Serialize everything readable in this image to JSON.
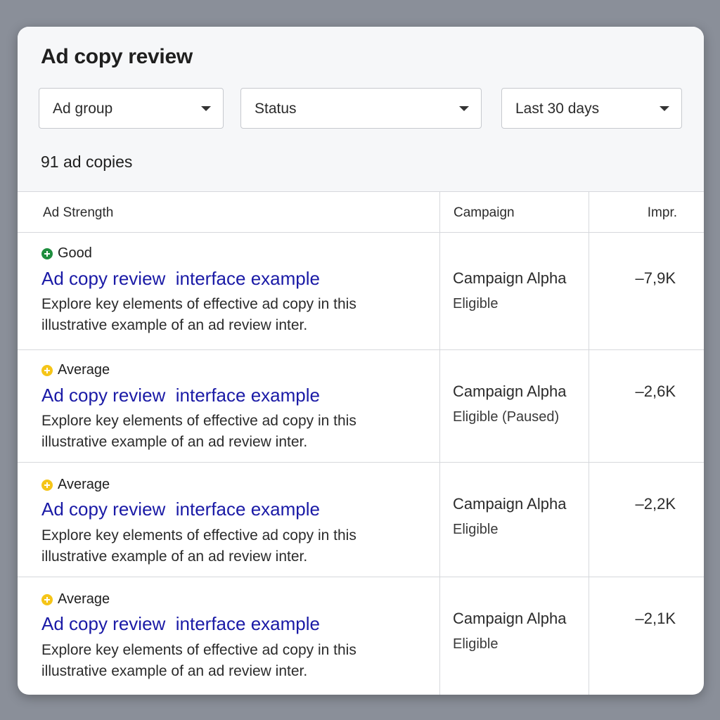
{
  "title": "Ad copy review",
  "filters": {
    "ad_group": "Ad group",
    "status": "Status",
    "date_range": "Last 30 days"
  },
  "count_label": "91 ad copies",
  "columns": {
    "strength": "Ad Strength",
    "campaign": "Campaign",
    "impressions": "Impr."
  },
  "colors": {
    "good": "#1e8e3e",
    "average": "#f5c518",
    "link": "#1a1aa6"
  },
  "rows": [
    {
      "strength": "Good",
      "strength_level": "good",
      "headline": "Ad copy review  interface example",
      "description": "Explore key elements of effective ad copy in this illustrative example of an ad review inter.",
      "campaign": "Campaign Alpha",
      "status": "Eligible",
      "impressions": "–7,9K"
    },
    {
      "strength": "Average",
      "strength_level": "average",
      "headline": "Ad copy review  interface example",
      "description": "Explore key elements of effective ad copy in this illustrative example of an ad review inter.",
      "campaign": "Campaign Alpha",
      "status": "Eligible (Paused)",
      "impressions": "–2,6K"
    },
    {
      "strength": "Average",
      "strength_level": "average",
      "headline": "Ad copy review  interface example",
      "description": "Explore key elements of effective ad copy in this illustrative example of an ad review inter.",
      "campaign": "Campaign Alpha",
      "status": "Eligible",
      "impressions": "–2,2K"
    },
    {
      "strength": "Average",
      "strength_level": "average",
      "headline": "Ad copy review  interface example",
      "description": "Explore key elements of effective ad copy in this illustrative example of an ad review inter.",
      "campaign": "Campaign Alpha",
      "status": "Eligible",
      "impressions": "–2,1K"
    }
  ]
}
